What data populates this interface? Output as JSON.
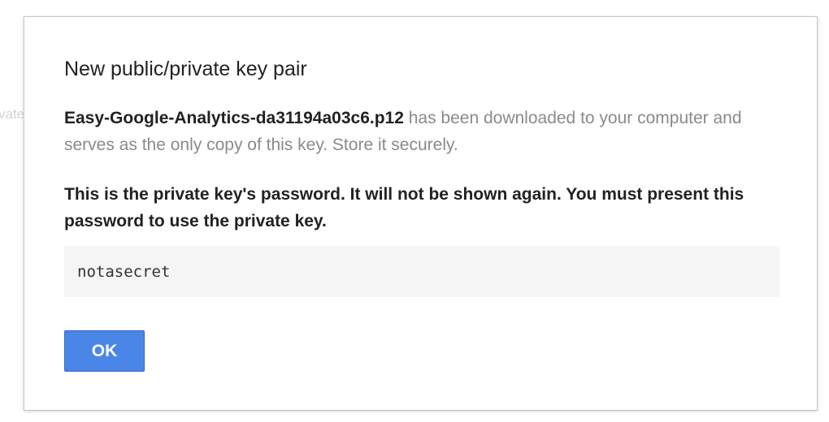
{
  "background": {
    "partial_text": "vate"
  },
  "dialog": {
    "title": "New public/private key pair",
    "filename": "Easy-Google-Analytics-da31194a03c6.p12",
    "description_rest": " has been downloaded to your computer and serves as the only copy of this key. Store it securely.",
    "warning": "This is the private key's password. It will not be shown again. You must present this password to use the private key.",
    "password": "notasecret",
    "ok_label": "OK"
  },
  "colors": {
    "accent": "#4a86e8",
    "title_text": "#222222",
    "muted_text": "#8a8a8a",
    "password_bg": "#f5f5f5"
  }
}
